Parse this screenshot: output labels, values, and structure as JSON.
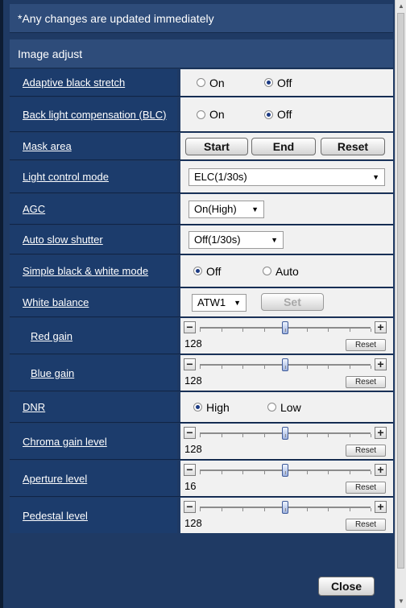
{
  "notice": "*Any changes are updated immediately",
  "section_title": "Image adjust",
  "adaptive_black_stretch": {
    "label": "Adaptive black stretch",
    "on": "On",
    "off": "Off",
    "selected": "Off"
  },
  "blc": {
    "label": "Back light compensation (BLC)",
    "on": "On",
    "off": "Off",
    "selected": "Off"
  },
  "mask_area": {
    "label": "Mask area",
    "start": "Start",
    "end": "End",
    "reset": "Reset"
  },
  "light_control_mode": {
    "label": "Light control mode",
    "value": "ELC(1/30s)"
  },
  "agc": {
    "label": "AGC",
    "value": "On(High)"
  },
  "auto_slow_shutter": {
    "label": "Auto slow shutter",
    "value": "Off(1/30s)"
  },
  "simple_bw_mode": {
    "label": "Simple black & white mode",
    "off": "Off",
    "auto": "Auto",
    "selected": "Off"
  },
  "white_balance": {
    "label": "White balance",
    "value": "ATW1",
    "set": "Set"
  },
  "sliders": {
    "red_gain": {
      "label": "Red gain",
      "value": "128",
      "position": 0.5,
      "reset": "Reset"
    },
    "blue_gain": {
      "label": "Blue gain",
      "value": "128",
      "position": 0.5,
      "reset": "Reset"
    },
    "chroma_gain": {
      "label": "Chroma gain level",
      "value": "128",
      "position": 0.5,
      "reset": "Reset"
    },
    "aperture": {
      "label": "Aperture level",
      "value": "16",
      "position": 0.5,
      "reset": "Reset"
    },
    "pedestal": {
      "label": "Pedestal level",
      "value": "128",
      "position": 0.5,
      "reset": "Reset"
    }
  },
  "dnr": {
    "label": "DNR",
    "high": "High",
    "low": "Low",
    "selected": "High"
  },
  "close": "Close",
  "colors": {
    "panel_bg": "#1f3a64",
    "label_bg": "#1c3c6c",
    "header_bg": "#2e4c7a",
    "control_bg": "#f1f1f1",
    "radio_selected": "#1b3a83"
  }
}
